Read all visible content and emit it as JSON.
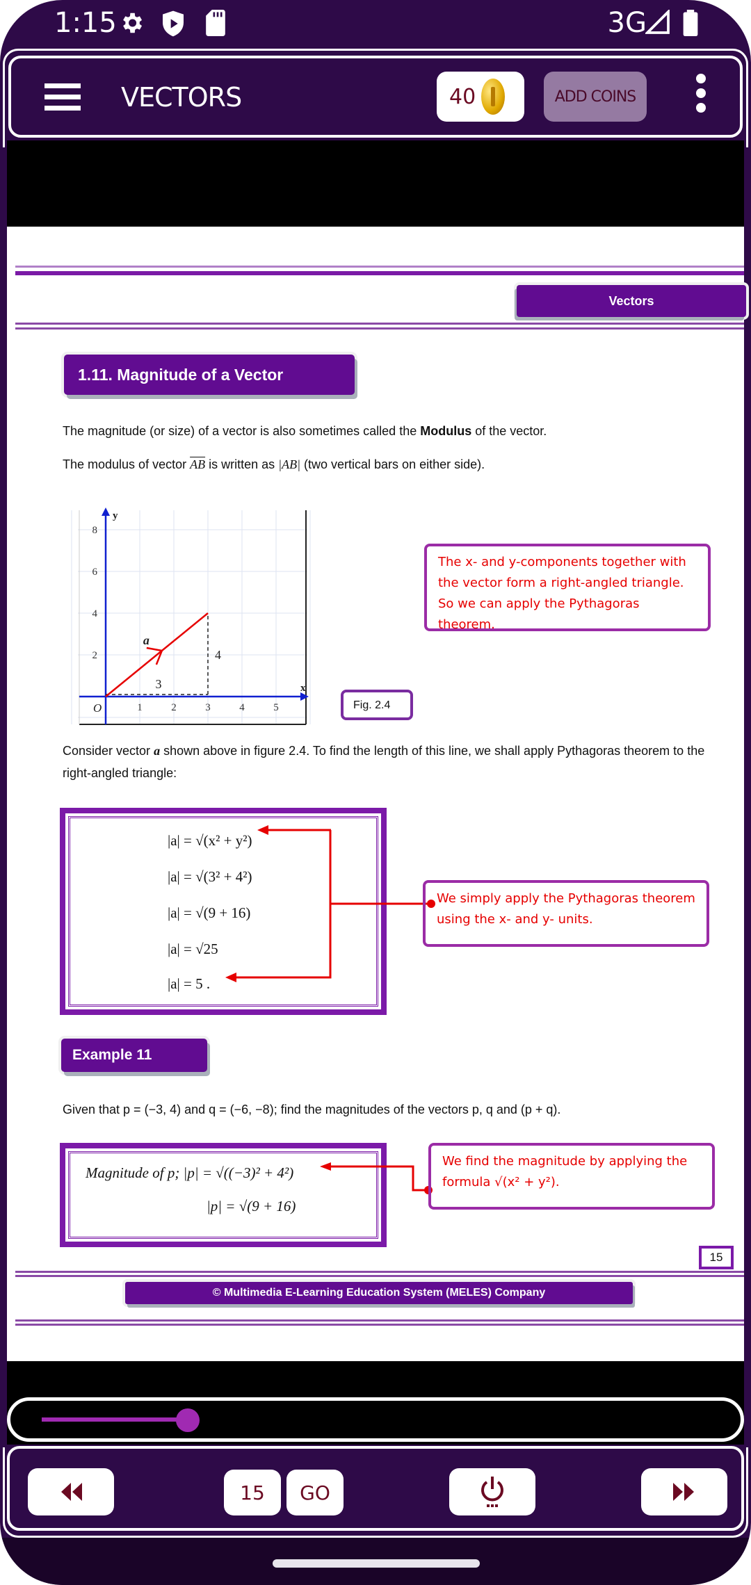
{
  "status_bar": {
    "time": "1:15",
    "icons": [
      "gear-icon",
      "shield-play-icon",
      "sd-card-icon"
    ],
    "network": "3G",
    "right_icons": [
      "signal-icon",
      "battery-icon"
    ]
  },
  "header": {
    "title": "VECTORS",
    "coin_count": "40",
    "add_coins_label": "ADD COINS"
  },
  "page": {
    "chapter_tag": "Vectors",
    "section_title": "1.11. Magnitude of a Vector",
    "para1_before": "The magnitude (or size) of a vector is also sometimes called the ",
    "para1_bold": "Modulus",
    "para1_after": " of the vector.",
    "para2_a": "The modulus of vector ",
    "para2_vec": "AB",
    "para2_b": " is written as ",
    "para2_abs": "|AB|",
    "para2_c": " (two vertical bars on either side).",
    "figure": {
      "x_ticks": [
        "1",
        "2",
        "3",
        "4",
        "5"
      ],
      "y_ticks": [
        "2",
        "4",
        "6",
        "8"
      ],
      "origin": "O",
      "x_label": "x",
      "y_label": "y",
      "vector_label": "a",
      "vector_end": [
        3,
        4
      ],
      "horizontal_label": "3",
      "vertical_label": "4"
    },
    "note1": "The x- and y-components together with the vector form a right-angled triangle. So we can apply the Pythagoras theorem.",
    "fig_label": "Fig. 2.4",
    "para3": "Consider vector a shown above in figure 2.4. To find the length of this line, we shall apply Pythagoras theorem to the right-angled triangle:",
    "para3_a": "Consider vector ",
    "para3_var": "a",
    "para3_b": " shown above in figure 2.4. To find the length of this line, we shall apply Pythagoras theorem to the right-angled triangle:",
    "steps": [
      "|a| = √(x² + y²)",
      "|a| = √(3² + 4²)",
      "|a| = √(9 + 16)",
      "|a| = √25",
      "|a| = 5 ."
    ],
    "note2": "We simply apply the Pythagoras theorem using the x- and y- units.",
    "example_title": "Example 11",
    "example_text": "Given that p = (−3, 4) and q = (−6, −8); find the magnitudes of the vectors p, q and (p + q).",
    "example_p": [
      "-3",
      "4"
    ],
    "example_q": [
      "-6",
      "-8"
    ],
    "solution": [
      "Magnitude of p;  |p| = √((−3)² + 4²)",
      "|p| = √(9 + 16)"
    ],
    "note3": "We find the magnitude by applying the formula √(x² + y²).",
    "page_number": "15",
    "copyright": "© Multimedia E-Learning Education System (MELES) Company"
  },
  "slider": {
    "progress": 0.22
  },
  "nav": {
    "prev_icon": "rewind-icon",
    "page_input": "15",
    "go_label": "GO",
    "power_icon": "power-icon",
    "next_icon": "fast-forward-icon"
  },
  "colors": {
    "app_bg": "#2e0a48",
    "accent_purple": "#610c91",
    "note_text": "#e60000",
    "slider": "#a02ab2"
  }
}
